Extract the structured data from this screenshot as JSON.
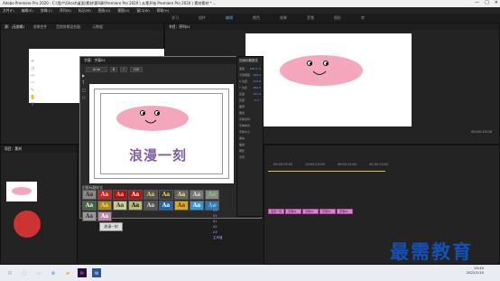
{
  "window": {
    "title": "Adobe Premiere Pro 2020 - C:\\用户\\Ghost\\桌面\\素材\\第6章\\Premiere Pro 2020 \\ 从零开始 Premiere Pro 2020 \\ 素材素材 * ...",
    "controls": [
      "—",
      "□",
      "✕"
    ]
  },
  "menu": [
    "文件(F)",
    "编辑(E)",
    "剪辑(C)",
    "序列(S)",
    "标记(M)",
    "图形(G)",
    "视图(V)",
    "窗口(W)",
    "帮助(H)"
  ],
  "workspace": {
    "tabs": [
      "学习",
      "组件",
      "编辑",
      "颜色",
      "效果",
      "音频",
      "图形",
      "库"
    ],
    "active_index": 2
  },
  "source_panel": {
    "tabs": [
      "源：(无剪辑)",
      "效果控件",
      "音频剪辑混合器：",
      "元数据",
      "项目：(无剪辑)"
    ],
    "active_index": 0
  },
  "program_panel": {
    "tabs": [
      "节目：序列01"
    ]
  },
  "title_editor": {
    "header": "字幕：字幕01",
    "font_family": "Arial",
    "font_size": "100",
    "title_text": "浪漫一刻",
    "styles_header": "旧版标题样式",
    "styles": [
      {
        "label": "Aa",
        "bg": "#888888",
        "fg": "#333333"
      },
      {
        "label": "Aa",
        "bg": "#cc2222",
        "fg": "#ffd0d0"
      },
      {
        "label": "Aa",
        "bg": "#aa1111",
        "fg": "#ffaaaa"
      },
      {
        "label": "Aa",
        "bg": "#bb1111",
        "fg": "#ffffff"
      },
      {
        "label": "Aa",
        "bg": "#555555",
        "fg": "#e8d46a"
      },
      {
        "label": "Aa",
        "bg": "#3a3a3a",
        "fg": "#f0e04a"
      },
      {
        "label": "Aa",
        "bg": "#666666",
        "fg": "#ffe27a"
      },
      {
        "label": "Aa",
        "bg": "#777777",
        "fg": "#e0e0e0"
      },
      {
        "label": "Aa",
        "bg": "#888888",
        "fg": "#8cd16a"
      },
      {
        "label": "Aa",
        "bg": "#446644",
        "fg": "#eeeeee"
      },
      {
        "label": "Aa",
        "bg": "#aa8822",
        "fg": "#ffdd44"
      },
      {
        "label": "Aa",
        "bg": "#cccc99",
        "fg": "#333333"
      },
      {
        "label": "Aa",
        "bg": "#bbbb77",
        "fg": "#111111"
      },
      {
        "label": "Aa",
        "bg": "#555555",
        "fg": "#dddddd"
      },
      {
        "label": "Aa",
        "bg": "#2266aa",
        "fg": "#ffffff"
      },
      {
        "label": "Aa",
        "bg": "#ddaa22",
        "fg": "#663300"
      },
      {
        "label": "Aa",
        "bg": "#3399dd",
        "fg": "#ffffff"
      },
      {
        "label": "Aa",
        "bg": "#3377aa",
        "fg": "#66ccff"
      },
      {
        "label": "Aa",
        "bg": "#999999",
        "fg": "#333333"
      },
      {
        "label": "Aa",
        "bg": "#bb88aa",
        "fg": "#ffffff"
      }
    ],
    "props_header": "旧版标题属性",
    "props_labels": [
      "变换",
      "不透明度",
      "X 位置",
      "Y 位置",
      "宽度",
      "高度",
      "旋转",
      "属性",
      "字体系列",
      "字体样式",
      "字体大小",
      "填充",
      "描边",
      "阴影",
      "背景"
    ],
    "props_values": [
      "100.0 %",
      "462.2",
      "315.8",
      "389.5",
      "101.8",
      "0.0 °"
    ]
  },
  "program_timecode": "00:00:23:00",
  "timeline": {
    "timecodes": [
      "00:00:05:00",
      "00:00:10:00",
      "00:00:15:00",
      "00:00:20:00"
    ],
    "clips": [
      "浪漫一刻",
      "字幕01",
      "字幕01",
      "字幕01",
      "字幕01"
    ],
    "track_labels": [
      "V3",
      "V2",
      "V1",
      "A1",
      "A2",
      "A3",
      "主声道"
    ]
  },
  "project_panel": {
    "header": "项目：素材",
    "items": [
      "浪漫一刻"
    ],
    "tooltip": "浪漫一刻"
  },
  "taskbar": {
    "time": "15:40",
    "date": "2022/1/10"
  },
  "watermark": "最需教育",
  "colors": {
    "pink": "#f4a6bd",
    "purple_text": "#7b5fa0",
    "clip": "#e07fd6",
    "accent": "#5aa2ff"
  }
}
